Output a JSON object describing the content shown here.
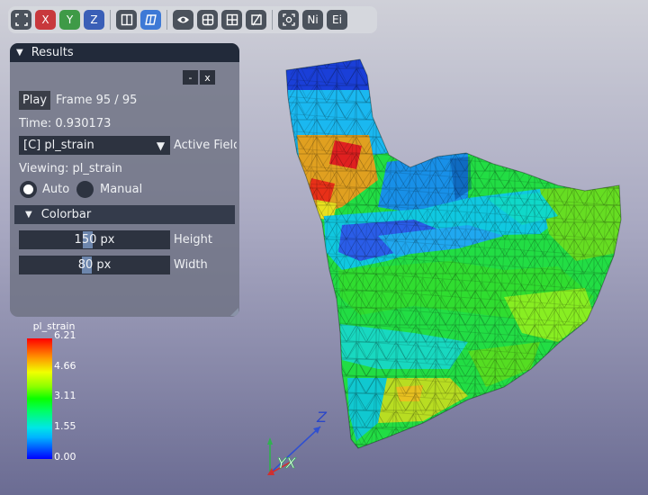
{
  "toolbar": {
    "buttons": [
      {
        "name": "fit-view-icon",
        "label": ""
      },
      {
        "name": "view-x-button",
        "label": "X"
      },
      {
        "name": "view-y-button",
        "label": "Y"
      },
      {
        "name": "view-z-button",
        "label": "Z"
      },
      {
        "name": "split-view-icon",
        "label": ""
      },
      {
        "name": "perspective-icon",
        "label": ""
      },
      {
        "name": "eye-icon",
        "label": ""
      },
      {
        "name": "grid-icon",
        "label": ""
      },
      {
        "name": "grid-alt-icon",
        "label": ""
      },
      {
        "name": "clip-icon",
        "label": ""
      },
      {
        "name": "screenshot-icon",
        "label": ""
      },
      {
        "name": "node-info-button",
        "label": "Ni"
      },
      {
        "name": "element-info-button",
        "label": "Ei"
      }
    ]
  },
  "results_panel": {
    "title": "Results",
    "minimize_label": "-",
    "close_label": "x",
    "play_label": "Play",
    "frame_text": "Frame 95 / 95",
    "time_text": "Time: 0.930173",
    "field_value": "[C] pl_strain",
    "field_caption": "Active Field",
    "viewing_text": "Viewing: pl_strain",
    "radio_auto": "Auto",
    "radio_manual": "Manual",
    "colorbar_section": "Colorbar",
    "height_value": "150 px",
    "height_label": "Height",
    "width_value": "80 px",
    "width_label": "Width"
  },
  "colorbar": {
    "title": "pl_strain",
    "ticks": [
      "6.21",
      "4.66",
      "3.11",
      "1.55",
      "0.00"
    ],
    "colors": [
      "#0000ff",
      "#00b4ff",
      "#00e6e6",
      "#00ff64",
      "#0aff00",
      "#8cff00",
      "#f0ff00",
      "#ff9600",
      "#ff0000"
    ]
  },
  "axes_triad": {
    "labels": [
      "Z",
      "YX"
    ],
    "colors": {
      "x": "#d03030",
      "y": "#30b050",
      "z": "#3050d0"
    }
  }
}
